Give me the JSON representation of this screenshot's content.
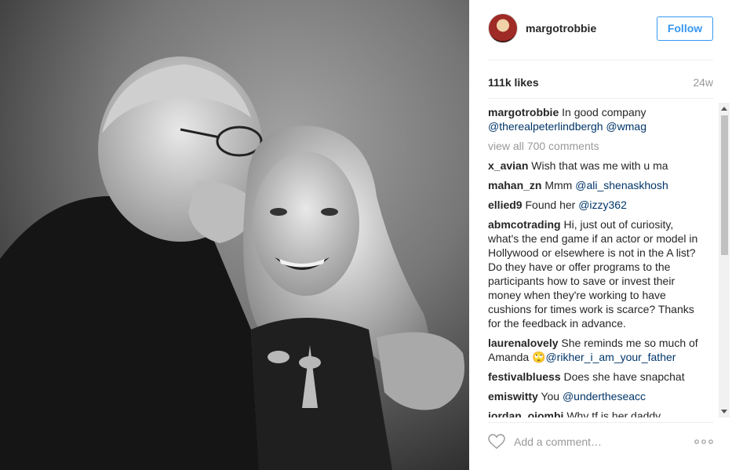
{
  "post": {
    "username": "margotrobbie",
    "follow_label": "Follow",
    "likes": "111k likes",
    "time": "24w",
    "caption": {
      "user": "margotrobbie",
      "text": "In good company",
      "mention1": "@therealpeterlindbergh",
      "mention2": "@wmag"
    },
    "view_all": "view all 700 comments",
    "comments": [
      {
        "user": "x_avian",
        "text": "Wish that was me with u ma",
        "mention": ""
      },
      {
        "user": "mahan_zn",
        "text": "Mmm",
        "mention": "@ali_shenaskhosh"
      },
      {
        "user": "ellied9",
        "text": "Found her",
        "mention": "@izzy362"
      },
      {
        "user": "abmcotrading",
        "text": "Hi, just out of curiosity, what's the end game if an actor or model in Hollywood or elsewhere is not in the A list? Do they have or offer programs to the participants how to save or invest their money when they're working to have cushions for times work is scarce? Thanks for the feedback in advance.",
        "mention": ""
      },
      {
        "user": "laurenalovely",
        "text": "She reminds me so much of Amanda 🙄",
        "mention": "@rikher_i_am_your_father"
      },
      {
        "user": "festivalbluess",
        "text": "Does she have snapchat",
        "mention": ""
      },
      {
        "user": "emiswitty",
        "text": "You",
        "mention": "@undertheseacc"
      },
      {
        "user": "jordan_ojombi",
        "text": "Why tf is her daddy",
        "mention": ""
      }
    ],
    "add_comment_placeholder": "Add a comment…"
  },
  "icons": {
    "like": "heart-icon",
    "more": "more-options-icon"
  },
  "colors": {
    "accent": "#3897f0",
    "mention": "#003569",
    "muted": "#999999"
  }
}
